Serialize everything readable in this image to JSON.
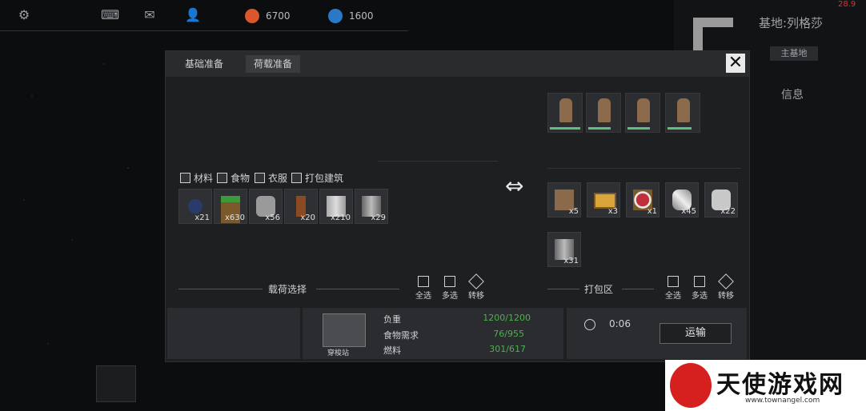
{
  "topbar": {
    "icons": [
      "gear-icon",
      "keyboard-icon",
      "mail-icon",
      "person-icon"
    ],
    "resource1": {
      "value": "6700",
      "color": "#d9572a"
    },
    "resource2": {
      "value": "1600",
      "color": "#2a79c9"
    }
  },
  "base": {
    "title": "基地:列格莎",
    "tag": "主基地",
    "info": "信息",
    "corner_num": "28.9"
  },
  "dialog": {
    "tabs": [
      "基础准备",
      "荷载准备"
    ],
    "close": "✕",
    "filters": [
      "材料",
      "食物",
      "衣服",
      "打包建筑"
    ],
    "load_items": [
      {
        "icon": "ore-icon",
        "qty": "x21"
      },
      {
        "icon": "crate-icon",
        "qty": "x630"
      },
      {
        "icon": "stone-icon",
        "qty": "x56"
      },
      {
        "icon": "wood-plank-icon",
        "qty": "x20"
      },
      {
        "icon": "steel-icon",
        "qty": "x210"
      },
      {
        "icon": "component-icon",
        "qty": "x29"
      }
    ],
    "load_section": {
      "label": "载荷选择",
      "select_all": "全选",
      "multi_select": "多选",
      "transfer": "转移"
    },
    "pack_section": {
      "label": "打包区",
      "select_all": "全选",
      "multi_select": "多选",
      "transfer": "转移"
    },
    "crew_count": 4,
    "pack_items": [
      {
        "icon": "leather-icon",
        "qty": "x5"
      },
      {
        "icon": "bread-icon",
        "qty": "x3"
      },
      {
        "icon": "meat-plate-icon",
        "qty": "x1"
      },
      {
        "icon": "pipe-icon",
        "qty": "x45"
      },
      {
        "icon": "silver-ore-icon",
        "qty": "x22"
      },
      {
        "icon": "component-icon",
        "qty": "x31"
      }
    ],
    "ship": {
      "label": "穿梭站"
    },
    "stats": [
      {
        "label": "负重",
        "value": "1200/1200"
      },
      {
        "label": "食物需求",
        "value": "76/955"
      },
      {
        "label": "燃料",
        "value": "301/617"
      }
    ],
    "time": "0:06",
    "transport": "运输"
  },
  "watermark": {
    "text": "天使游戏网",
    "url": "www.townangel.com"
  }
}
